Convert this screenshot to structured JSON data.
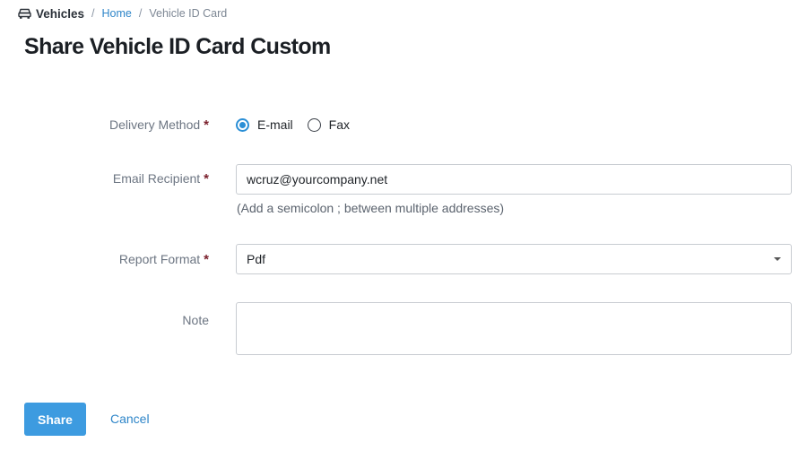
{
  "breadcrumb": {
    "icon": "car-icon",
    "root": "Vehicles",
    "separator": "/",
    "home": "Home",
    "current": "Vehicle ID Card"
  },
  "page_title": "Share Vehicle ID Card Custom",
  "form": {
    "required_marker": "*",
    "delivery_method": {
      "label": "Delivery Method",
      "options": [
        {
          "label": "E-mail",
          "checked": true
        },
        {
          "label": "Fax",
          "checked": false
        }
      ]
    },
    "email_recipient": {
      "label": "Email Recipient",
      "value": "wcruz@yourcompany.net",
      "help": "(Add a semicolon ; between multiple addresses)"
    },
    "report_format": {
      "label": "Report Format",
      "value": "Pdf"
    },
    "note": {
      "label": "Note",
      "value": ""
    }
  },
  "actions": {
    "share": "Share",
    "cancel": "Cancel"
  },
  "colors": {
    "accent": "#3d9be0",
    "link": "#2f86c9",
    "required": "#7a1f2b"
  }
}
